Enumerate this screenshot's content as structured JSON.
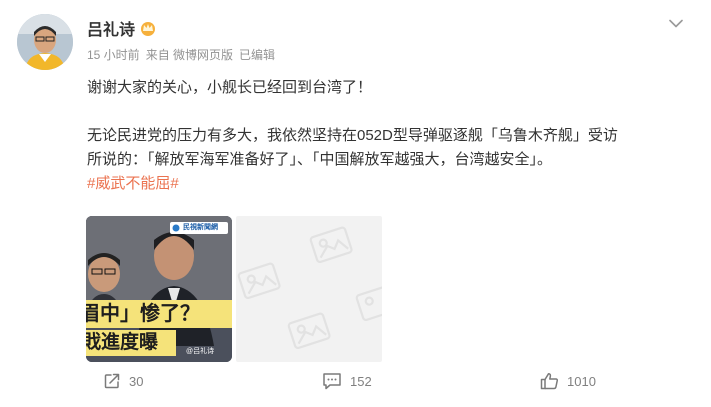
{
  "post": {
    "author": "吕礼诗",
    "time": "15 小时前",
    "source": "来自 微博网页版",
    "edited": "已编辑",
    "text_line1": "谢谢大家的关心，小舰长已经回到台湾了！",
    "text_line2": "无论民进党的压力有多大，我依然坚持在052D型导弹驱逐舰「乌鲁木齐舰」受访",
    "text_line3": "所说的：「解放军海军准备好了」、「中国解放军越强大，台湾越安全」。",
    "topic": "#威武不能屈#"
  },
  "thumbnail": {
    "logo_text": "民視新聞網",
    "caption_line1": "眉中」惨了？",
    "caption_line2": "戝進度曝",
    "watermark": "@吕礼诗"
  },
  "actions": {
    "repost_count": "30",
    "comment_count": "152",
    "like_count": "1010"
  },
  "colors": {
    "topic": "#eb7350",
    "caption_bg": "#f5e37a"
  }
}
